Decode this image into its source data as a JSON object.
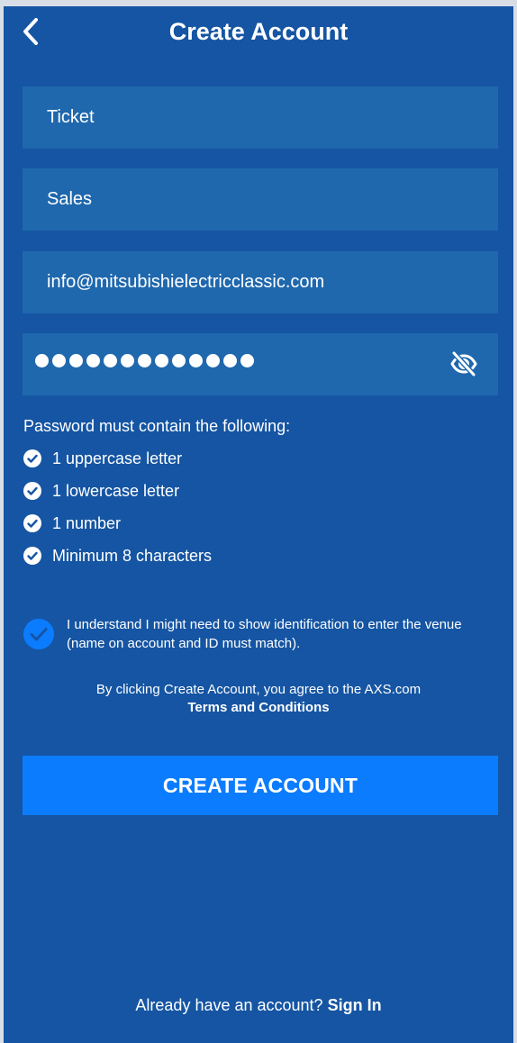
{
  "header": {
    "title": "Create Account",
    "back_icon": "chevron-left-icon"
  },
  "form": {
    "first_name": "Ticket",
    "last_name": "Sales",
    "email": "info@mitsubishielectricclassic.com",
    "password_masked": "●●●●●●●●●●●●●",
    "password_length": 13,
    "visibility_icon": "eye-slash-icon"
  },
  "requirements": {
    "title": "Password must contain the following:",
    "items": [
      "1 uppercase letter",
      "1 lowercase letter",
      "1 number",
      "Minimum 8 characters"
    ]
  },
  "agreement": {
    "checked": true,
    "text": "I understand I might need to show identification to enter the venue (name on account and ID must match)."
  },
  "terms": {
    "prefix": "By clicking Create Account, you agree to the AXS.com",
    "link": "Terms and Conditions"
  },
  "actions": {
    "create_label": "CREATE ACCOUNT"
  },
  "footer": {
    "prompt": "Already have an account?",
    "signin_label": "Sign In"
  },
  "colors": {
    "background": "#1555a3",
    "field": "#1f68ad",
    "button": "#0c7cff",
    "checkbox": "#0c7cff"
  }
}
